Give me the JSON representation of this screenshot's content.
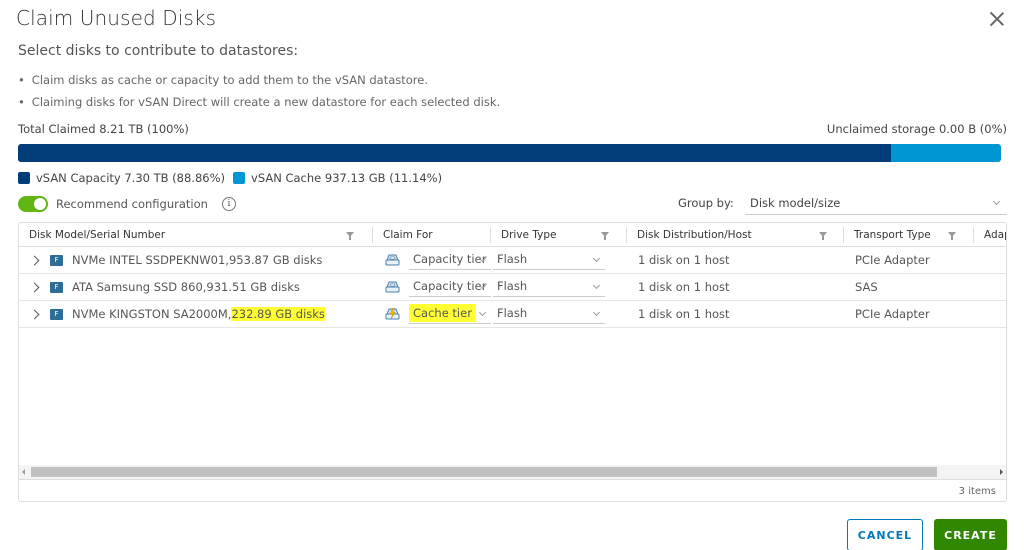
{
  "dialog": {
    "title": "Claim Unused Disks",
    "subtitle": "Select disks to contribute to datastores:",
    "bullets": [
      "Claim disks as cache or capacity to add them to the vSAN datastore.",
      "Claiming disks for vSAN Direct will create a new datastore for each selected disk."
    ]
  },
  "storage": {
    "total_claimed": "Total Claimed 8.21 TB (100%)",
    "unclaimed": "Unclaimed storage 0.00 B (0%)",
    "segments": [
      {
        "name": "vSAN Capacity",
        "label": "vSAN Capacity 7.30 TB (88.86%)",
        "percent": 88.86,
        "color": "#003d79"
      },
      {
        "name": "vSAN Cache",
        "label": "vSAN Cache 937.13 GB (11.14%)",
        "percent": 11.14,
        "color": "#0095d3"
      }
    ]
  },
  "recommend": {
    "label": "Recommend configuration",
    "enabled": true,
    "info_icon": "info-icon"
  },
  "group_by": {
    "label": "Group by:",
    "value": "Disk model/size"
  },
  "table": {
    "columns": [
      {
        "label": "Disk Model/Serial Number",
        "filter": true
      },
      {
        "label": "Claim For",
        "filter": false
      },
      {
        "label": "Drive Type",
        "filter": true
      },
      {
        "label": "Disk Distribution/Host",
        "filter": true
      },
      {
        "label": "Transport Type",
        "filter": true
      },
      {
        "label": "Adap",
        "filter": false
      }
    ],
    "rows": [
      {
        "model": "NVMe INTEL SSDPEKNW01, ",
        "size": "953.87 GB disks",
        "highlight_size": false,
        "claim_for": "Capacity tier",
        "claim_icon": "capacity-disk-icon",
        "highlight_claim": false,
        "drive_type": "Flash",
        "distribution": "1 disk on 1 host",
        "transport": "PCIe Adapter"
      },
      {
        "model": "ATA Samsung SSD 860, ",
        "size": "931.51 GB disks",
        "highlight_size": false,
        "claim_for": "Capacity tier",
        "claim_icon": "capacity-disk-icon",
        "highlight_claim": false,
        "drive_type": "Flash",
        "distribution": "1 disk on 1 host",
        "transport": "SAS"
      },
      {
        "model": "NVMe KINGSTON SA2000M, ",
        "size": "232.89 GB disks",
        "highlight_size": true,
        "claim_for": "Cache tier",
        "claim_icon": "cache-disk-icon",
        "highlight_claim": true,
        "drive_type": "Flash",
        "distribution": "1 disk on 1 host",
        "transport": "PCIe Adapter"
      }
    ],
    "drive_badge": "F",
    "footer": "3 items"
  },
  "buttons": {
    "cancel": "CANCEL",
    "create": "CREATE"
  }
}
